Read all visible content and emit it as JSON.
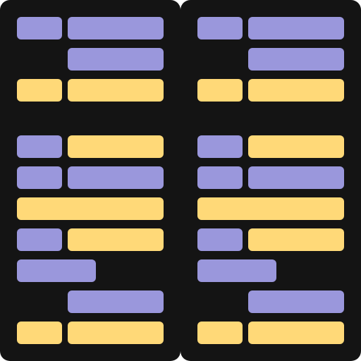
{
  "colors": {
    "background": "#141414",
    "purple": "#9a97dc",
    "yellow": "#ffd978"
  },
  "panels": [
    {
      "name": "panel-left",
      "rows": [
        [
          "purple-short",
          "purple-long"
        ],
        [
          "empty",
          "purple-long"
        ],
        [
          "yellow-short",
          "yellow-long"
        ],
        [
          "gap"
        ],
        [
          "purple-short",
          "yellow-long"
        ],
        [
          "purple-short",
          "purple-long"
        ],
        [
          "yellow-full"
        ],
        [
          "purple-short",
          "yellow-long"
        ],
        [
          "purple-medium"
        ],
        [
          "empty",
          "purple-long"
        ],
        [
          "yellow-short",
          "yellow-long"
        ]
      ]
    },
    {
      "name": "panel-right",
      "rows": [
        [
          "purple-short",
          "purple-long"
        ],
        [
          "empty",
          "purple-long"
        ],
        [
          "yellow-short",
          "yellow-long"
        ],
        [
          "gap"
        ],
        [
          "purple-short",
          "yellow-long"
        ],
        [
          "purple-short",
          "purple-long"
        ],
        [
          "yellow-full"
        ],
        [
          "purple-short",
          "yellow-long"
        ],
        [
          "purple-medium"
        ],
        [
          "empty",
          "purple-long"
        ],
        [
          "yellow-short",
          "yellow-long"
        ]
      ]
    }
  ]
}
